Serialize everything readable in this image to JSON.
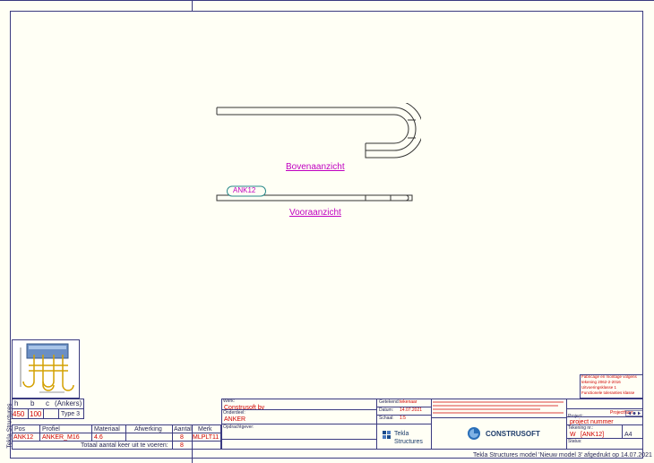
{
  "views": {
    "top_label": "Bovenaanzicht",
    "front_label": "Vooraanzicht",
    "part_mark": "ANK12"
  },
  "side_text": "Tekla Structures",
  "dimensions_table": {
    "headers": [
      "h",
      "b",
      "c",
      "(Ankers)"
    ],
    "values": [
      "450",
      "100",
      "Type 3"
    ]
  },
  "parts_table": {
    "headers": [
      "Pos",
      "Profiel",
      "Materiaal",
      "Afwerking",
      "Aantal",
      "Merk"
    ],
    "row": [
      "ANK12",
      "ANKER_M16",
      "4.6",
      "",
      "8",
      "MLPLT11"
    ],
    "total_label": "Totaal aantal keer uit te voeren:",
    "total_value": "8"
  },
  "title_block": {
    "client_label": "Werk:",
    "client_value": "Construsoft bv",
    "object_label": "Onderdeel:",
    "object_value": "ANKER",
    "remarks_label": "Opdrachtgever:",
    "drawn_label": "Getekend:",
    "drawn_value": "tekenaar",
    "date_label": "Datum:",
    "date_value": "14.07.2021",
    "scale_label": "Schaal:",
    "scale_value": "1:5",
    "tekla_brand": "Tekla",
    "tekla_product": "Structures",
    "construsoft_brand": "CONSTRUSOFT",
    "project_label": "Project:",
    "project_value": "project nummer",
    "drawing_label": "Tekening nr.:",
    "drawing_value": "W",
    "drawing_ref": "[ANK12]",
    "format_value": "A4",
    "status_label": "Status:",
    "phase_label": "Projectfase:"
  },
  "revision_lines": [
    "Fabricage en montage volgens",
    "tekening 2062-2-2016",
    "Uitvoeringsklasse 1",
    "Functionele toleranties klasse"
  ],
  "footer": "Tekla Structures model 'Nieuw model 3' afgedrukt op 14.07.2021",
  "colors": {
    "frame": "#3a3a80",
    "text_red": "#d00000",
    "label_magenta": "#c000c0",
    "paper": "#fffff5"
  }
}
